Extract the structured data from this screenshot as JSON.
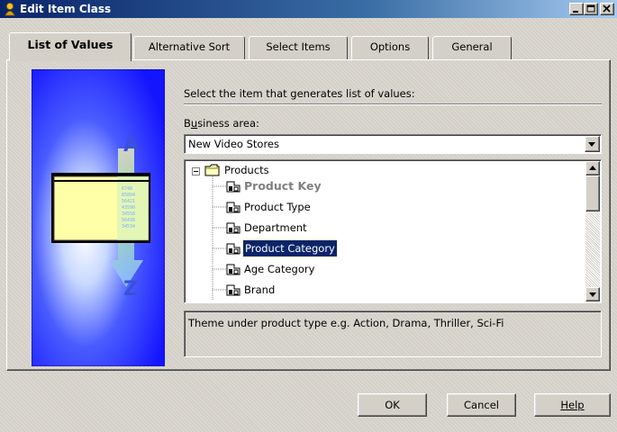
{
  "window": {
    "title": "Edit Item Class",
    "controls": {
      "minimize": "_",
      "maximize": "□",
      "close": "×"
    }
  },
  "tabs": [
    {
      "label": "List of Values",
      "active": true
    },
    {
      "label": "Alternative Sort",
      "active": false
    },
    {
      "label": "Select Items",
      "active": false
    },
    {
      "label": "Options",
      "active": false
    },
    {
      "label": "General",
      "active": false
    }
  ],
  "illustration": {
    "letter_top": "A",
    "letter_bottom": "Z",
    "numbers": [
      "6748",
      "85094",
      "56421",
      "43590",
      "34558",
      "56438",
      "34534"
    ]
  },
  "instruction": "Select the item that generates list of values:",
  "business_area": {
    "label": "Business area:",
    "mnemonic": "u",
    "value": "New Video Stores"
  },
  "tree": {
    "root": "Products",
    "items": [
      {
        "label": "Product Key",
        "state": "disabled-bold"
      },
      {
        "label": "Product Type",
        "state": "normal"
      },
      {
        "label": "Department",
        "state": "normal"
      },
      {
        "label": "Product Category",
        "state": "selected"
      },
      {
        "label": "Age Category",
        "state": "normal"
      },
      {
        "label": "Brand",
        "state": "normal"
      }
    ]
  },
  "description": "Theme under product type e.g. Action, Drama, Thriller, Sci-Fi",
  "buttons": {
    "ok": "OK",
    "cancel": "Cancel",
    "help": "Help"
  },
  "colors": {
    "selection": "#0a246a",
    "titlebar": "#0a246a",
    "illustration_blue": "#1a1aff"
  }
}
